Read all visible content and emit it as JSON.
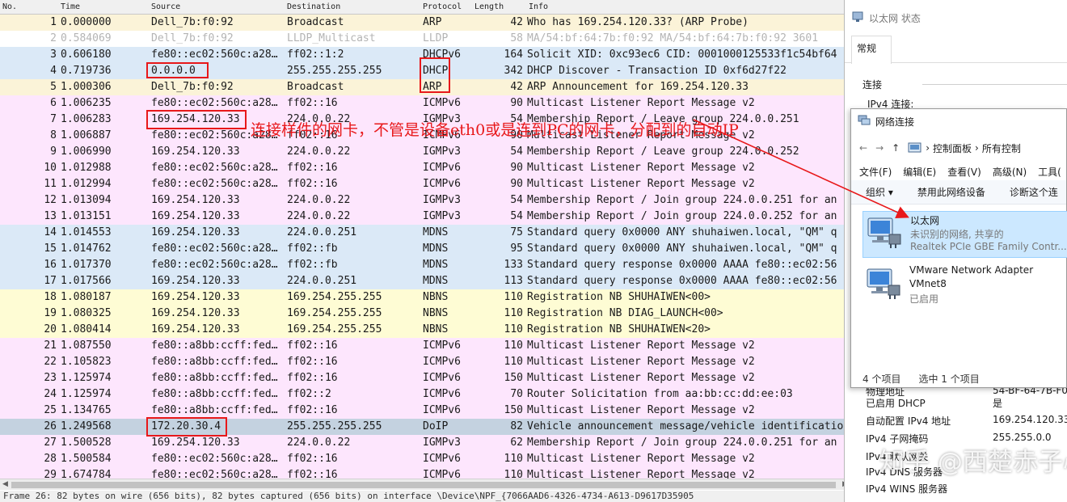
{
  "columns": {
    "no": "No.",
    "time": "Time",
    "source": "Source",
    "destination": "Destination",
    "protocol": "Protocol",
    "length": "Length",
    "info": "Info"
  },
  "colors": {
    "arp": "#fbf3d8",
    "lldp": "#ffffff",
    "ipv6": "#dbe9f7",
    "dhcp": "#dbe9f7",
    "icmpv6": "#fde6fd",
    "igmp": "#fde6fd",
    "mdns": "#dbe9f7",
    "nbns": "#fefcd4",
    "doip_selected": "#c4d2e0",
    "highlight": "#e8181a"
  },
  "packets": [
    {
      "no": "1",
      "time": "0.000000",
      "source": "Dell_7b:f0:92",
      "destination": "Broadcast",
      "protocol": "ARP",
      "length": "42",
      "info": "Who has 169.254.120.33? (ARP Probe)",
      "color": "arp"
    },
    {
      "no": "2",
      "time": "0.584069",
      "source": "Dell_7b:f0:92",
      "destination": "LLDP_Multicast",
      "protocol": "LLDP",
      "length": "58",
      "info": "MA/54:bf:64:7b:f0:92 MA/54:bf:64:7b:f0:92 3601",
      "color": "lldp"
    },
    {
      "no": "3",
      "time": "0.606180",
      "source": "fe80::ec02:560c:a28…",
      "destination": "ff02::1:2",
      "protocol": "DHCPv6",
      "length": "164",
      "info": "Solicit XID: 0xc93ec6 CID: 0001000125533f1c54bf64",
      "color": "ipv6"
    },
    {
      "no": "4",
      "time": "0.719736",
      "source": "0.0.0.0",
      "destination": "255.255.255.255",
      "protocol": "DHCP",
      "length": "342",
      "info": "DHCP Discover - Transaction ID 0xf6d27f22",
      "color": "dhcp"
    },
    {
      "no": "5",
      "time": "1.000306",
      "source": "Dell_7b:f0:92",
      "destination": "Broadcast",
      "protocol": "ARP",
      "length": "42",
      "info": "ARP Announcement for 169.254.120.33",
      "color": "arp"
    },
    {
      "no": "6",
      "time": "1.006235",
      "source": "fe80::ec02:560c:a28…",
      "destination": "ff02::16",
      "protocol": "ICMPv6",
      "length": "90",
      "info": "Multicast Listener Report Message v2",
      "color": "icmpv6"
    },
    {
      "no": "7",
      "time": "1.006283",
      "source": "169.254.120.33",
      "destination": "224.0.0.22",
      "protocol": "IGMPv3",
      "length": "54",
      "info": "Membership Report / Leave group 224.0.0.251",
      "color": "igmp"
    },
    {
      "no": "8",
      "time": "1.006887",
      "source": "fe80::ec02:560c:a28…",
      "destination": "ff02::16",
      "protocol": "ICMPv6",
      "length": "90",
      "info": "Multicast Listener Report Message v2",
      "color": "icmpv6"
    },
    {
      "no": "9",
      "time": "1.006990",
      "source": "169.254.120.33",
      "destination": "224.0.0.22",
      "protocol": "IGMPv3",
      "length": "54",
      "info": "Membership Report / Leave group 224.0.0.252",
      "color": "igmp"
    },
    {
      "no": "10",
      "time": "1.012988",
      "source": "fe80::ec02:560c:a28…",
      "destination": "ff02::16",
      "protocol": "ICMPv6",
      "length": "90",
      "info": "Multicast Listener Report Message v2",
      "color": "icmpv6"
    },
    {
      "no": "11",
      "time": "1.012994",
      "source": "fe80::ec02:560c:a28…",
      "destination": "ff02::16",
      "protocol": "ICMPv6",
      "length": "90",
      "info": "Multicast Listener Report Message v2",
      "color": "icmpv6"
    },
    {
      "no": "12",
      "time": "1.013094",
      "source": "169.254.120.33",
      "destination": "224.0.0.22",
      "protocol": "IGMPv3",
      "length": "54",
      "info": "Membership Report / Join group 224.0.0.251 for an",
      "color": "igmp"
    },
    {
      "no": "13",
      "time": "1.013151",
      "source": "169.254.120.33",
      "destination": "224.0.0.22",
      "protocol": "IGMPv3",
      "length": "54",
      "info": "Membership Report / Join group 224.0.0.252 for an",
      "color": "igmp"
    },
    {
      "no": "14",
      "time": "1.014553",
      "source": "169.254.120.33",
      "destination": "224.0.0.251",
      "protocol": "MDNS",
      "length": "75",
      "info": "Standard query 0x0000 ANY shuhaiwen.local, \"QM\" q",
      "color": "mdns"
    },
    {
      "no": "15",
      "time": "1.014762",
      "source": "fe80::ec02:560c:a28…",
      "destination": "ff02::fb",
      "protocol": "MDNS",
      "length": "95",
      "info": "Standard query 0x0000 ANY shuhaiwen.local, \"QM\" q",
      "color": "mdns"
    },
    {
      "no": "16",
      "time": "1.017370",
      "source": "fe80::ec02:560c:a28…",
      "destination": "ff02::fb",
      "protocol": "MDNS",
      "length": "133",
      "info": "Standard query response 0x0000 AAAA fe80::ec02:56",
      "color": "mdns"
    },
    {
      "no": "17",
      "time": "1.017566",
      "source": "169.254.120.33",
      "destination": "224.0.0.251",
      "protocol": "MDNS",
      "length": "113",
      "info": "Standard query response 0x0000 AAAA fe80::ec02:56",
      "color": "mdns"
    },
    {
      "no": "18",
      "time": "1.080187",
      "source": "169.254.120.33",
      "destination": "169.254.255.255",
      "protocol": "NBNS",
      "length": "110",
      "info": "Registration NB SHUHAIWEN<00>",
      "color": "nbns"
    },
    {
      "no": "19",
      "time": "1.080325",
      "source": "169.254.120.33",
      "destination": "169.254.255.255",
      "protocol": "NBNS",
      "length": "110",
      "info": "Registration NB DIAG_LAUNCH<00>",
      "color": "nbns"
    },
    {
      "no": "20",
      "time": "1.080414",
      "source": "169.254.120.33",
      "destination": "169.254.255.255",
      "protocol": "NBNS",
      "length": "110",
      "info": "Registration NB SHUHAIWEN<20>",
      "color": "nbns"
    },
    {
      "no": "21",
      "time": "1.087550",
      "source": "fe80::a8bb:ccff:fed…",
      "destination": "ff02::16",
      "protocol": "ICMPv6",
      "length": "110",
      "info": "Multicast Listener Report Message v2",
      "color": "icmpv6"
    },
    {
      "no": "22",
      "time": "1.105823",
      "source": "fe80::a8bb:ccff:fed…",
      "destination": "ff02::16",
      "protocol": "ICMPv6",
      "length": "110",
      "info": "Multicast Listener Report Message v2",
      "color": "icmpv6"
    },
    {
      "no": "23",
      "time": "1.125974",
      "source": "fe80::a8bb:ccff:fed…",
      "destination": "ff02::16",
      "protocol": "ICMPv6",
      "length": "150",
      "info": "Multicast Listener Report Message v2",
      "color": "icmpv6"
    },
    {
      "no": "24",
      "time": "1.125974",
      "source": "fe80::a8bb:ccff:fed…",
      "destination": "ff02::2",
      "protocol": "ICMPv6",
      "length": "70",
      "info": "Router Solicitation from aa:bb:cc:dd:ee:03",
      "color": "icmpv6"
    },
    {
      "no": "25",
      "time": "1.134765",
      "source": "fe80::a8bb:ccff:fed…",
      "destination": "ff02::16",
      "protocol": "ICMPv6",
      "length": "150",
      "info": "Multicast Listener Report Message v2",
      "color": "icmpv6"
    },
    {
      "no": "26",
      "time": "1.249568",
      "source": "172.20.30.4",
      "destination": "255.255.255.255",
      "protocol": "DoIP",
      "length": "82",
      "info": "Vehicle announcement message/vehicle identificatio",
      "color": "doip_selected"
    },
    {
      "no": "27",
      "time": "1.500528",
      "source": "169.254.120.33",
      "destination": "224.0.0.22",
      "protocol": "IGMPv3",
      "length": "62",
      "info": "Membership Report / Join group 224.0.0.251 for an",
      "color": "igmp"
    },
    {
      "no": "28",
      "time": "1.500584",
      "source": "fe80::ec02:560c:a28…",
      "destination": "ff02::16",
      "protocol": "ICMPv6",
      "length": "110",
      "info": "Multicast Listener Report Message v2",
      "color": "icmpv6"
    },
    {
      "no": "29",
      "time": "1.674784",
      "source": "fe80::ec02:560c:a28…",
      "destination": "ff02::16",
      "protocol": "ICMPv6",
      "length": "110",
      "info": "Multicast Listener Report Message v2",
      "color": "icmpv6"
    }
  ],
  "status_bar": "Frame 26: 82 bytes on wire (656 bits), 82 bytes captured (656 bits) on interface \\Device\\NPF_{7066AAD6-4326-4734-A613-D9617D35905",
  "annotation": "连接样件的网卡，不管是设备eth0或是连到PC的网卡，分配到的自动IP",
  "status_dialog": {
    "title": "以太网 状态",
    "tab": "常规",
    "section": "连接",
    "ipv4_conn": "IPv4 连接:",
    "details": [
      {
        "label": "物理地址",
        "value": "54-BF-64-7B-F0"
      },
      {
        "label": "已启用 DHCP",
        "value": "是"
      },
      {
        "label": "自动配置 IPv4 地址",
        "value": "169.254.120.33"
      },
      {
        "label": "IPv4 子网掩码",
        "value": "255.255.0.0"
      },
      {
        "label": "IPv4 默认网关",
        "value": ""
      },
      {
        "label": "IPv4 DNS 服务器",
        "value": ""
      },
      {
        "label": "IPv4 WINS 服务器",
        "value": ""
      }
    ]
  },
  "net_dialog": {
    "title": "网络连接",
    "breadcrumb": [
      "控制面板",
      "所有控制"
    ],
    "menu": [
      "文件(F)",
      "编辑(E)",
      "查看(V)",
      "高级(N)",
      "工具("
    ],
    "commands": {
      "organize": "组织 ▾",
      "disable": "禁用此网络设备",
      "diagnose": "诊断这个连"
    },
    "adapters": [
      {
        "name": "以太网",
        "line2": "未识别的网络, 共享的",
        "line3": "Realtek PCIe GBE Family Contr..."
      },
      {
        "name": "VMware Network Adapter",
        "line2": "VMnet8",
        "line3": "已启用"
      }
    ],
    "status_count": "4 个项目",
    "status_selected": "选中 1 个项目"
  },
  "watermark": "知乎 @西楚赤子心"
}
